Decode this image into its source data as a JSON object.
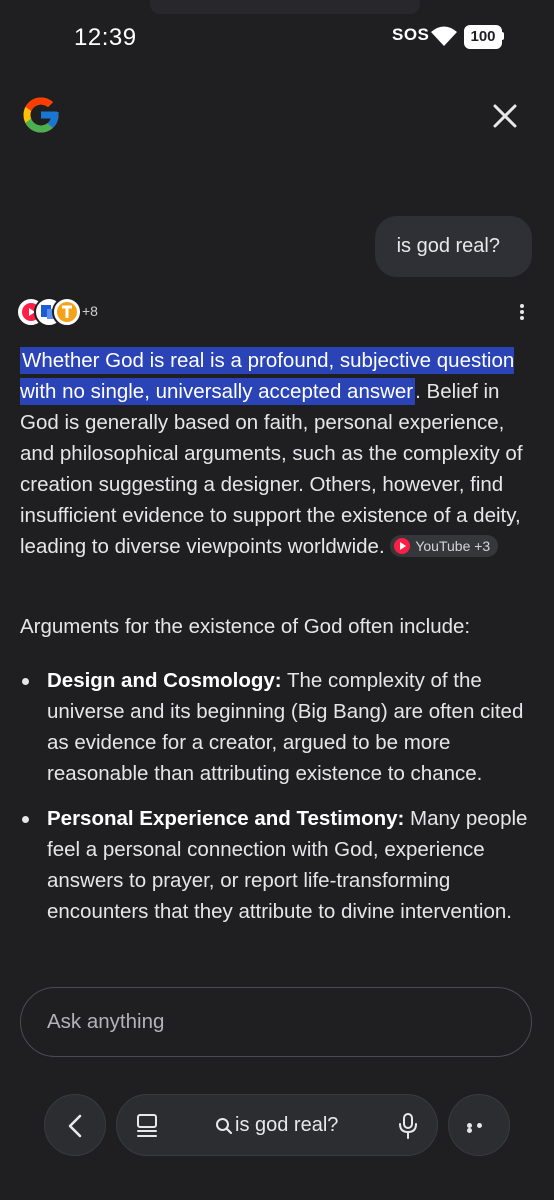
{
  "status_bar": {
    "time": "12:39",
    "sos": "SOS",
    "battery": "100"
  },
  "header": {
    "logo_icon": "google-g-icon",
    "close_icon": "close-icon"
  },
  "conversation": {
    "user_query": "is god real?",
    "sources": {
      "icons": [
        "youtube-icon",
        "blue-doc-icon",
        "orange-t-icon"
      ],
      "count": "+8"
    },
    "answer": {
      "highlighted": "Whether God is real is a profound, subjective question with no single, universally accepted answer",
      "rest": ". Belief in God is generally based on faith, personal experience, and philosophical arguments, such as the complexity of creation suggesting a designer. Others, however, find insufficient evidence to support the existence of a deity, leading to diverse viewpoints worldwide. ",
      "chip": "YouTube +3"
    },
    "args_intro": "Arguments for the existence of God often include:",
    "bullets": [
      {
        "title": "Design and Cosmology:",
        "text": " The complexity of the universe and its beginning (Big Bang) are often cited as evidence for a creator, argued to be more reasonable than attributing existence to chance."
      },
      {
        "title": "Personal Experience and Testimony:",
        "text": " Many people feel a personal connection with God, experience answers to prayer, or report life-transforming encounters that they attribute to divine intervention."
      }
    ]
  },
  "input": {
    "placeholder": "Ask anything"
  },
  "bottom_bar": {
    "query": "is god real?",
    "icons": [
      "chevron-left-icon",
      "tabs-icon",
      "search-icon",
      "mic-icon",
      "more-icon"
    ]
  },
  "colors": {
    "background": "#1f1f22",
    "highlight": "#2a44b8",
    "bubble": "#2f3035"
  }
}
